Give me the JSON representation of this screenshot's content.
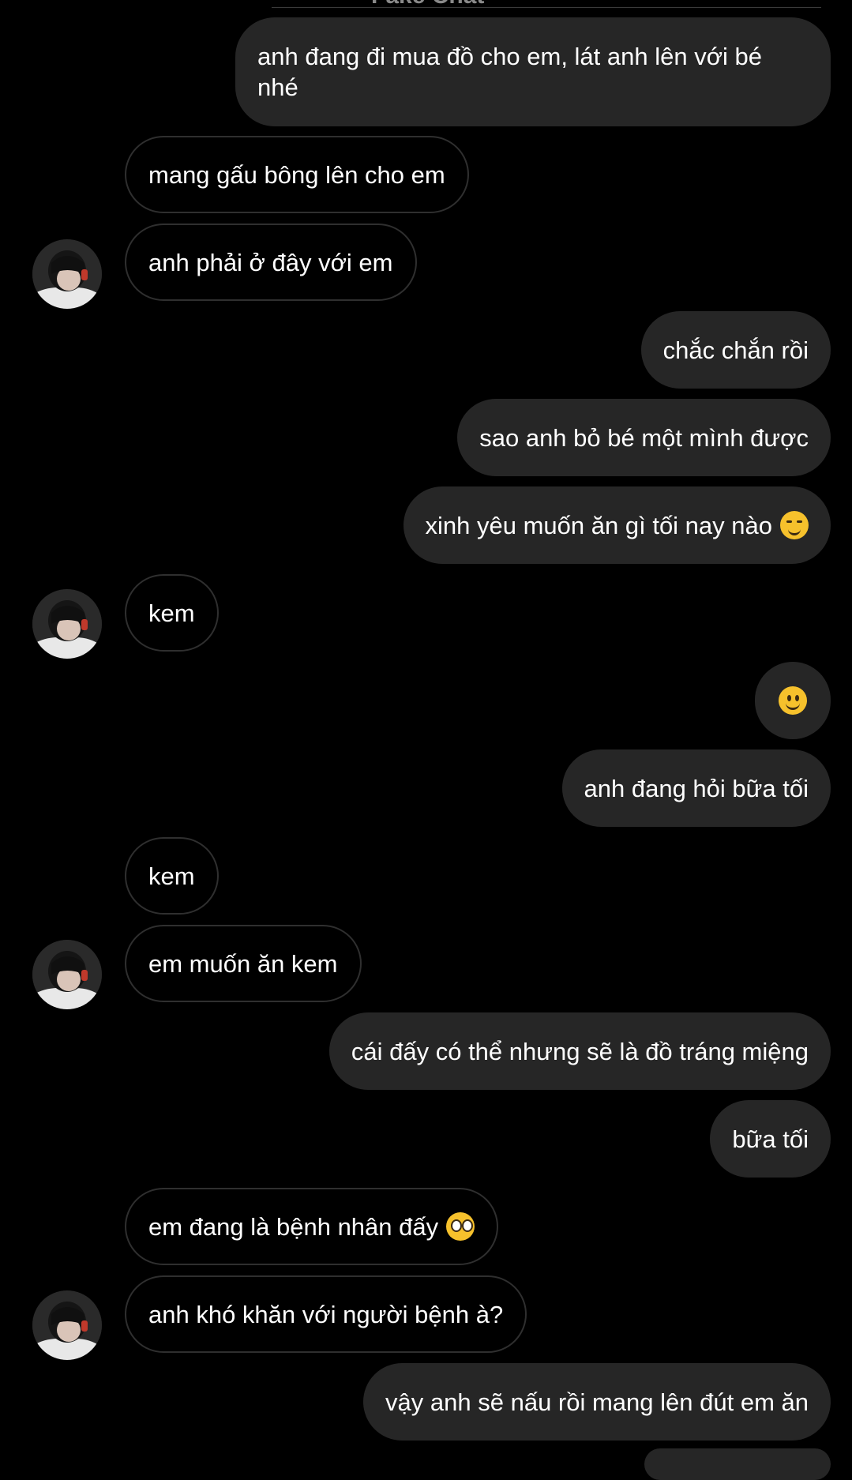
{
  "header": {
    "title_fragment": "Fake Chat"
  },
  "colors": {
    "background": "#000000",
    "my_bubble": "#262626",
    "their_bubble_border": "#2f2f2f",
    "text": "#ffffff"
  },
  "messages": [
    {
      "sender": "me",
      "text": "anh đang đi mua đồ cho em, lát anh lên với bé nhé"
    },
    {
      "sender": "them",
      "text": "mang gấu bông lên cho em"
    },
    {
      "sender": "them",
      "text": "anh phải ở đây với em"
    },
    {
      "sender": "me",
      "text": "chắc chắn rồi"
    },
    {
      "sender": "me",
      "text": "sao anh bỏ bé một mình được"
    },
    {
      "sender": "me",
      "text": "xinh yêu muốn ăn gì tối nay nào",
      "emoji": "smiling-face-with-smiling-eyes-icon"
    },
    {
      "sender": "them",
      "text": "kem"
    },
    {
      "sender": "me",
      "text": "",
      "emoji": "slightly-smiling-face-icon"
    },
    {
      "sender": "me",
      "text": "anh đang hỏi bữa tối"
    },
    {
      "sender": "them",
      "text": "kem"
    },
    {
      "sender": "them",
      "text": "em muốn ăn kem"
    },
    {
      "sender": "me",
      "text": "cái đấy có thể nhưng sẽ là đồ tráng miệng"
    },
    {
      "sender": "me",
      "text": "bữa tối"
    },
    {
      "sender": "them",
      "text": "em đang là bệnh nhân đấy",
      "emoji": "pleading-face-icon"
    },
    {
      "sender": "them",
      "text": "anh khó khăn với người bệnh à?"
    },
    {
      "sender": "me",
      "text": "vậy anh sẽ nấu rồi mang lên đút em ăn"
    }
  ]
}
